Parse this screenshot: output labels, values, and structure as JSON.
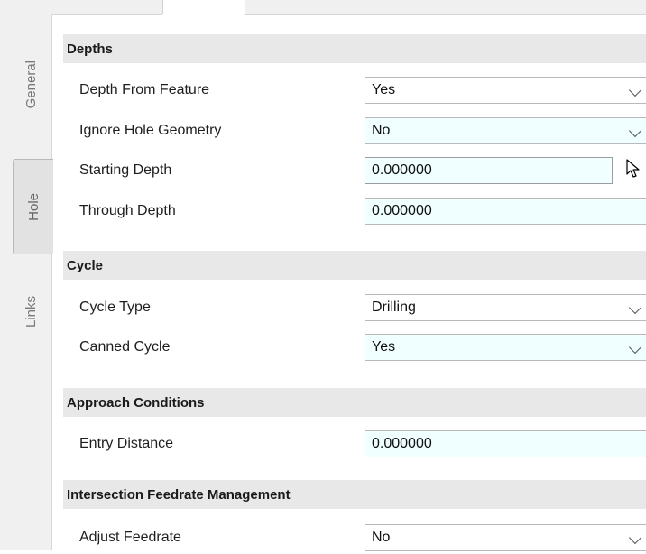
{
  "tabs": {
    "general": "General",
    "hole": "Hole",
    "links": "Links",
    "active": "hole"
  },
  "sections": {
    "depths": {
      "title": "Depths",
      "rows": [
        {
          "label": "Depth From Feature",
          "value": "Yes"
        },
        {
          "label": "Ignore Hole Geometry",
          "value": "No"
        },
        {
          "label": "Starting Depth",
          "value": "0.000000"
        },
        {
          "label": "Through Depth",
          "value": "0.000000"
        }
      ]
    },
    "cycle": {
      "title": "Cycle",
      "rows": [
        {
          "label": "Cycle Type",
          "value": "Drilling"
        },
        {
          "label": "Canned Cycle",
          "value": "Yes"
        }
      ]
    },
    "approach": {
      "title": "Approach Conditions",
      "rows": [
        {
          "label": "Entry Distance",
          "value": "0.000000"
        }
      ]
    },
    "intersection": {
      "title": "Intersection Feedrate Management",
      "rows": [
        {
          "label": "Adjust Feedrate",
          "value": "No"
        }
      ]
    }
  },
  "colors": {
    "section_bg": "#e8e8e8",
    "field_tint": "#f0ffff",
    "tab_bg": "#f0f0f0"
  }
}
